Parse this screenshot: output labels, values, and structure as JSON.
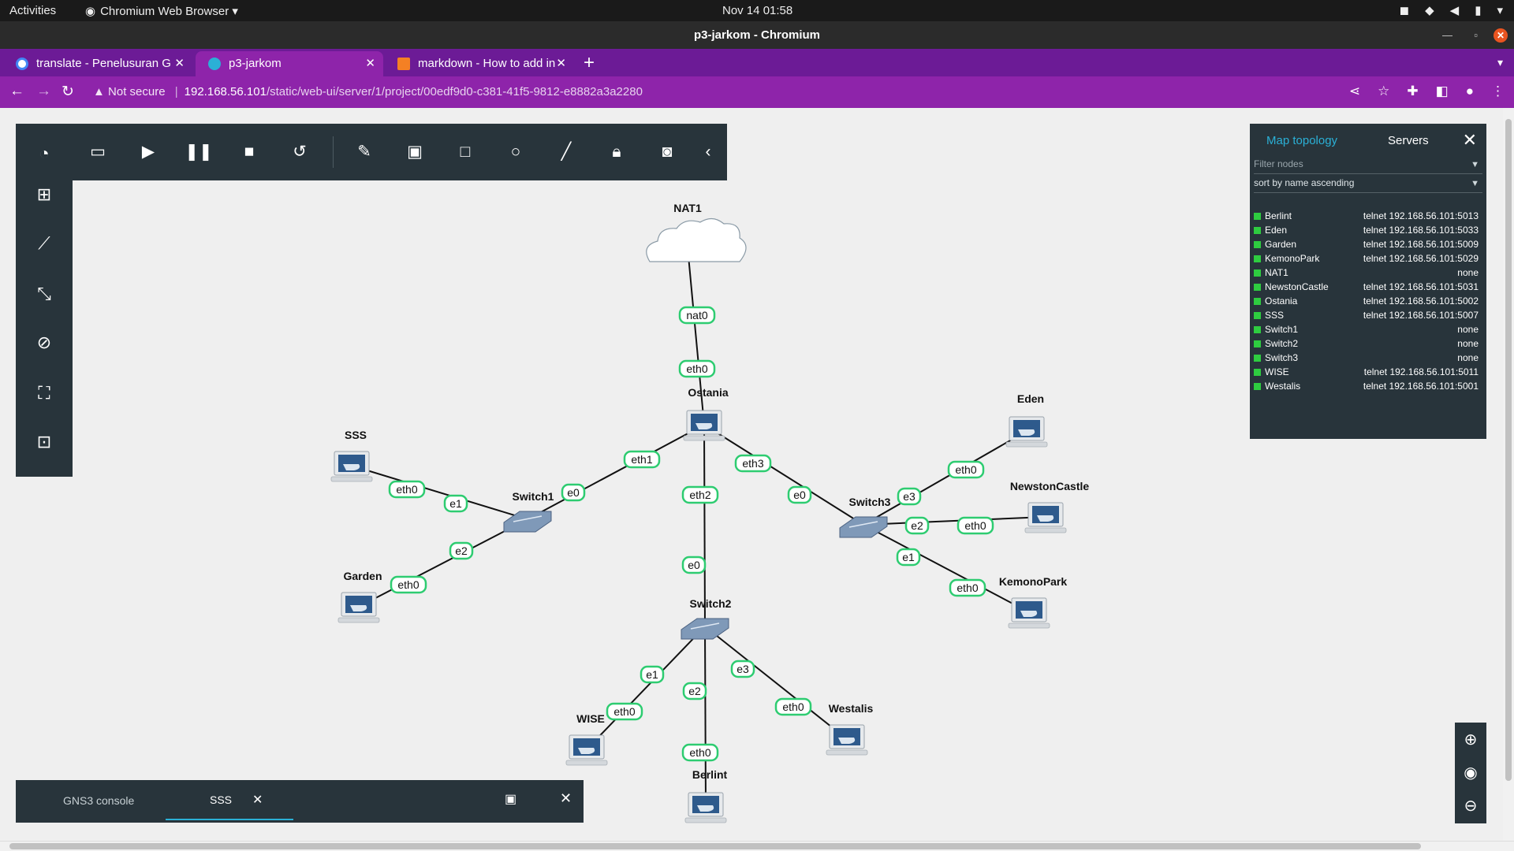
{
  "system_bar": {
    "activities": "Activities",
    "app_menu": "Chromium Web Browser ▾",
    "clock": "Nov 14  01:58"
  },
  "window": {
    "title": "p3-jarkom - Chromium"
  },
  "tabs": [
    {
      "label": "translate - Penelusuran G",
      "icon_color": "#4285f4"
    },
    {
      "label": "p3-jarkom",
      "icon_color": "#2bb0d6"
    },
    {
      "label": "markdown - How to add in",
      "icon_color": "#f48024"
    }
  ],
  "address_bar": {
    "security": "Not secure",
    "host": "192.168.56.101",
    "path": "/static/web-ui/server/1/project/00edf9d0-c381-41f5-9812-e8882a3a2280"
  },
  "topology_panel": {
    "tab_map": "Map topology",
    "tab_servers": "Servers",
    "filter_placeholder": "Filter nodes",
    "sort_label": "sort by name ascending",
    "status_color": "#2ecc40",
    "nodes": [
      {
        "name": "Berlint",
        "console": "telnet 192.168.56.101:5013"
      },
      {
        "name": "Eden",
        "console": "telnet 192.168.56.101:5033"
      },
      {
        "name": "Garden",
        "console": "telnet 192.168.56.101:5009"
      },
      {
        "name": "KemonoPark",
        "console": "telnet 192.168.56.101:5029"
      },
      {
        "name": "NAT1",
        "console": "none"
      },
      {
        "name": "NewstonCastle",
        "console": "telnet 192.168.56.101:5031"
      },
      {
        "name": "Ostania",
        "console": "telnet 192.168.56.101:5002"
      },
      {
        "name": "SSS",
        "console": "telnet 192.168.56.101:5007"
      },
      {
        "name": "Switch1",
        "console": "none"
      },
      {
        "name": "Switch2",
        "console": "none"
      },
      {
        "name": "Switch3",
        "console": "none"
      },
      {
        "name": "WISE",
        "console": "telnet 192.168.56.101:5011"
      },
      {
        "name": "Westalis",
        "console": "telnet 192.168.56.101:5001"
      }
    ]
  },
  "console_bar": {
    "tab_main": "GNS3 console",
    "tab_active": "SSS"
  },
  "diagram": {
    "colors": {
      "link": "#111111",
      "label_border": "#2ecc71",
      "cloud": "#ffffff",
      "switch": "#7f99b8"
    },
    "nodes": {
      "nat1": {
        "name": "NAT1",
        "kind": "cloud"
      },
      "ostania": {
        "name": "Ostania",
        "kind": "host"
      },
      "sss": {
        "name": "SSS",
        "kind": "host"
      },
      "garden": {
        "name": "Garden",
        "kind": "host"
      },
      "switch1": {
        "name": "Switch1",
        "kind": "switch"
      },
      "switch2": {
        "name": "Switch2",
        "kind": "switch"
      },
      "switch3": {
        "name": "Switch3",
        "kind": "switch"
      },
      "eden": {
        "name": "Eden",
        "kind": "host"
      },
      "newstoncastle": {
        "name": "NewstonCastle",
        "kind": "host"
      },
      "kemonopark": {
        "name": "KemonoPark",
        "kind": "host"
      },
      "wise": {
        "name": "WISE",
        "kind": "host"
      },
      "berlint": {
        "name": "Berlint",
        "kind": "host"
      },
      "westalis": {
        "name": "Westalis",
        "kind": "host"
      }
    },
    "links": [
      {
        "from": "nat1",
        "to": "ostania",
        "from_port": "nat0",
        "to_port": "eth0"
      },
      {
        "from": "ostania",
        "to": "switch1",
        "from_port": "eth1",
        "to_port": "e0"
      },
      {
        "from": "ostania",
        "to": "switch2",
        "from_port": "eth2",
        "to_port": "e0"
      },
      {
        "from": "ostania",
        "to": "switch3",
        "from_port": "eth3",
        "to_port": "e0"
      },
      {
        "from": "sss",
        "to": "switch1",
        "from_port": "eth0",
        "to_port": "e1"
      },
      {
        "from": "garden",
        "to": "switch1",
        "from_port": "eth0",
        "to_port": "e2"
      },
      {
        "from": "eden",
        "to": "switch3",
        "from_port": "eth0",
        "to_port": "e3"
      },
      {
        "from": "newstoncastle",
        "to": "switch3",
        "from_port": "eth0",
        "to_port": "e2"
      },
      {
        "from": "kemonopark",
        "to": "switch3",
        "from_port": "eth0",
        "to_port": "e1"
      },
      {
        "from": "wise",
        "to": "switch2",
        "from_port": "eth0",
        "to_port": "e1"
      },
      {
        "from": "berlint",
        "to": "switch2",
        "from_port": "eth0",
        "to_port": "e2"
      },
      {
        "from": "westalis",
        "to": "switch2",
        "from_port": "eth0",
        "to_port": "e3"
      }
    ]
  }
}
